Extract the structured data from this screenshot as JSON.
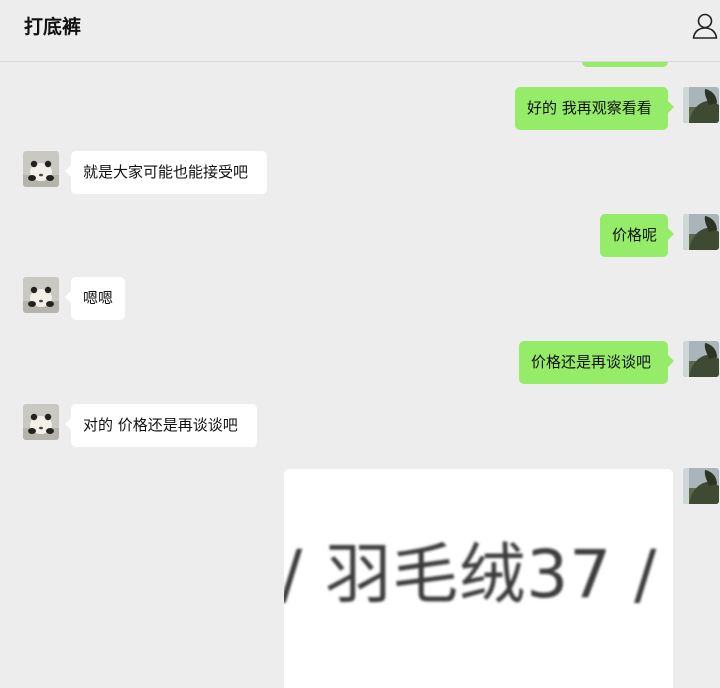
{
  "header": {
    "title": "打底裤",
    "profile_icon": "person-icon"
  },
  "messages": [
    {
      "side": "out",
      "text": "好的 我再观察看看",
      "avatar": "landscape-avatar"
    },
    {
      "side": "in",
      "text": "就是大家可能也能接受吧",
      "avatar": "panda-avatar"
    },
    {
      "side": "out",
      "text": "价格呢",
      "avatar": "landscape-avatar"
    },
    {
      "side": "in",
      "text": "嗯嗯",
      "avatar": "panda-avatar"
    },
    {
      "side": "out",
      "text": "价格还是再谈谈吧",
      "avatar": "landscape-avatar"
    },
    {
      "side": "in",
      "text": "对的 价格还是再谈谈吧",
      "avatar": "panda-avatar"
    }
  ],
  "image_message": {
    "side": "out",
    "image_text": "/ 羽毛绒37 /"
  },
  "colors": {
    "background": "#ededed",
    "outgoing_bubble": "#95ec69",
    "incoming_bubble": "#ffffff"
  }
}
